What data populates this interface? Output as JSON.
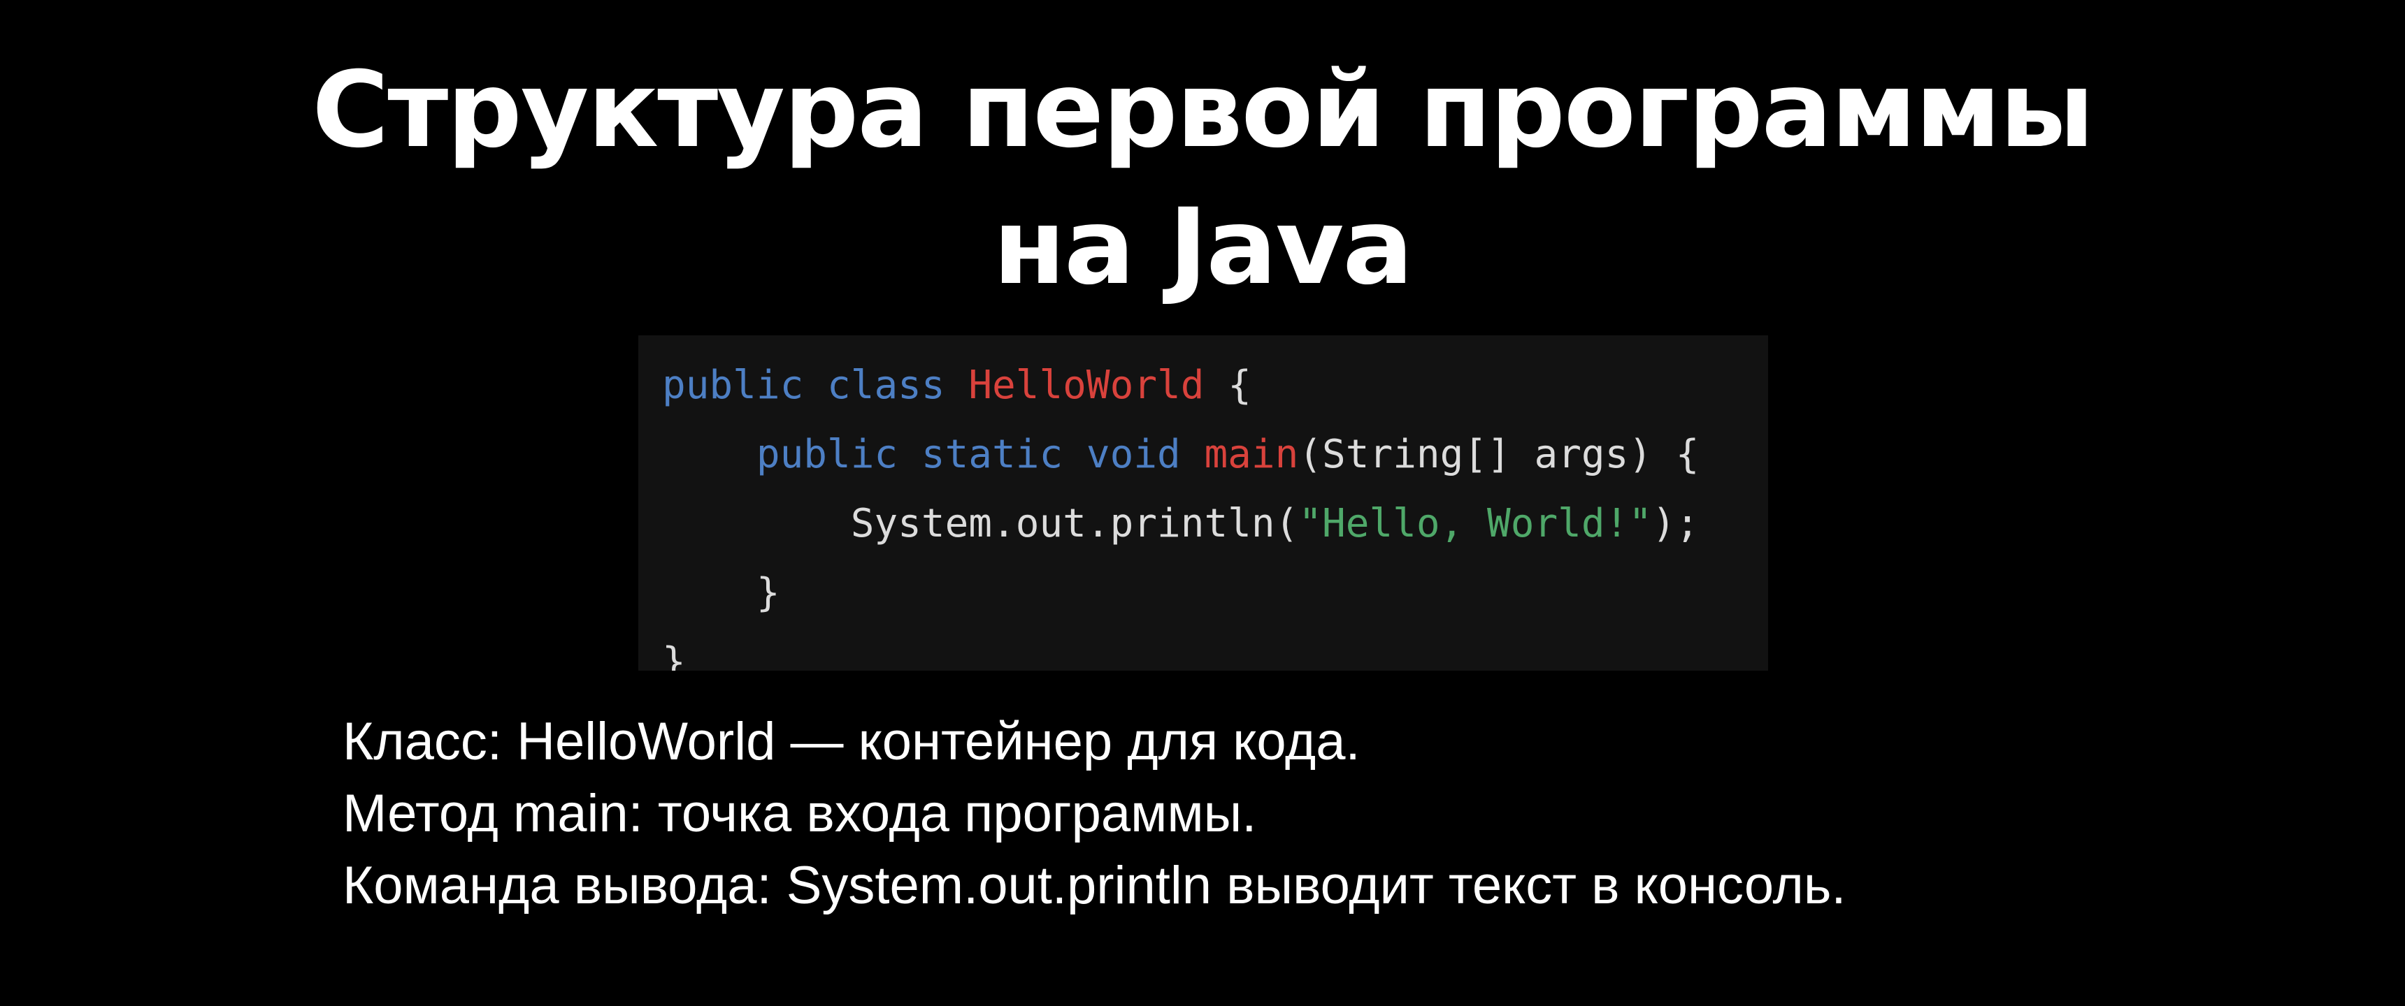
{
  "slide": {
    "title_line1": "Структура первой программы",
    "title_line2": "на Java",
    "code": {
      "line1": {
        "kw1": "public",
        "kw2": "class",
        "cls": "HelloWorld",
        "rest": "{"
      },
      "line2": {
        "indent": "    ",
        "kw1": "public",
        "kw2": "static",
        "kw3": "void",
        "method": "main",
        "rest": "(String[] args) {"
      },
      "line3": {
        "indent": "        ",
        "pre": "System.out.println(",
        "str": "\"Hello, World!\"",
        "post": ");"
      },
      "line4": {
        "indent": "    ",
        "text": "}"
      },
      "line5": {
        "text": "}"
      }
    },
    "bullets": [
      "Класс: HelloWorld — контейнер для кода.",
      "Метод main: точка входа программы.",
      "Команда вывода: System.out.println выводит текст в консоль."
    ]
  },
  "colors": {
    "background": "#000000",
    "code_background": "#121212",
    "keyword": "#4d7fc4",
    "class_name": "#d9423c",
    "string": "#4fa869",
    "plain": "#dcdcdc",
    "text": "#ffffff"
  }
}
